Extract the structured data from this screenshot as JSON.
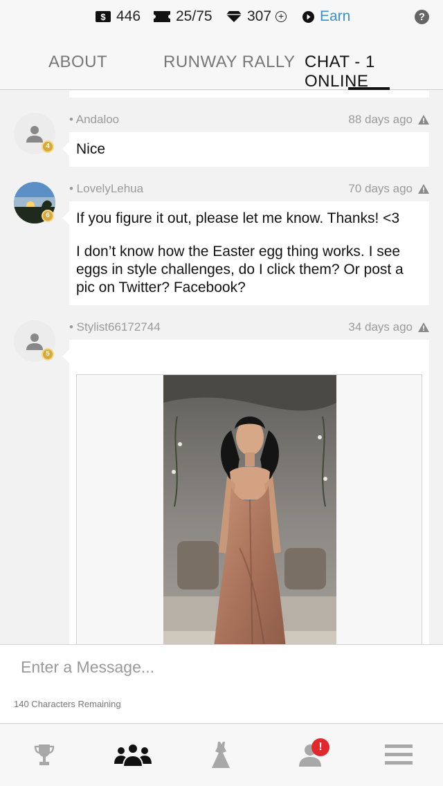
{
  "currency": {
    "cash": "446",
    "tickets": "25/75",
    "diamonds": "307",
    "earn_label": "Earn"
  },
  "tabs": [
    {
      "label": "ABOUT"
    },
    {
      "label": "RUNWAY RALLY"
    },
    {
      "label": "CHAT - 1 ONLINE"
    }
  ],
  "messages": [
    {
      "author": "• Andaloo",
      "time": "88 days ago",
      "level": "4",
      "paragraphs": [
        "Nice"
      ]
    },
    {
      "author": "• LovelyLehua",
      "time": "70 days ago",
      "level": "6",
      "paragraphs": [
        "If you figure it out, please let me know. Thanks! <3",
        "I don’t know how the Easter egg thing works. I see eggs in style challenges, do I click them? Or post a pic on Twitter? Facebook?"
      ]
    },
    {
      "author": "• Stylist66172744",
      "time": "34 days ago",
      "level": "5",
      "paragraphs": [
        ""
      ]
    }
  ],
  "composer": {
    "placeholder": "Enter a Message...",
    "remaining": "140 Characters Remaining"
  },
  "nav": {
    "notification_badge": "!",
    "items": [
      "trophy-icon",
      "community-icon",
      "dress-icon",
      "profile-icon",
      "menu-icon"
    ]
  },
  "colors": {
    "accent_blue": "#3a8fd0",
    "badge_red": "#e0282e",
    "level_gold": "#d7a83a"
  }
}
